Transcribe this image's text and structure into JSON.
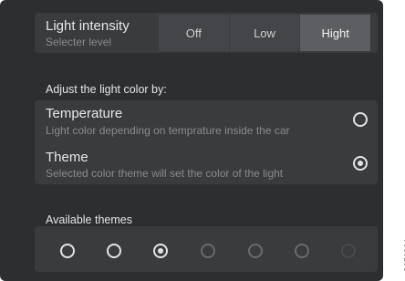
{
  "light_intensity": {
    "title": "Light intensity",
    "subtitle": "Selecter level",
    "options": [
      "Off",
      "Low",
      "Hight"
    ],
    "selected": "Hight"
  },
  "adjust": {
    "heading": "Adjust the light color by:",
    "options": [
      {
        "title": "Temperature",
        "subtitle": "Light color depending on temprature inside the car",
        "selected": false
      },
      {
        "title": "Theme",
        "subtitle": "Selected color theme will set the color of the light",
        "selected": true
      }
    ]
  },
  "themes": {
    "heading": "Available themes",
    "selected_index": 2,
    "count": 7
  },
  "figure_id": "G053824"
}
